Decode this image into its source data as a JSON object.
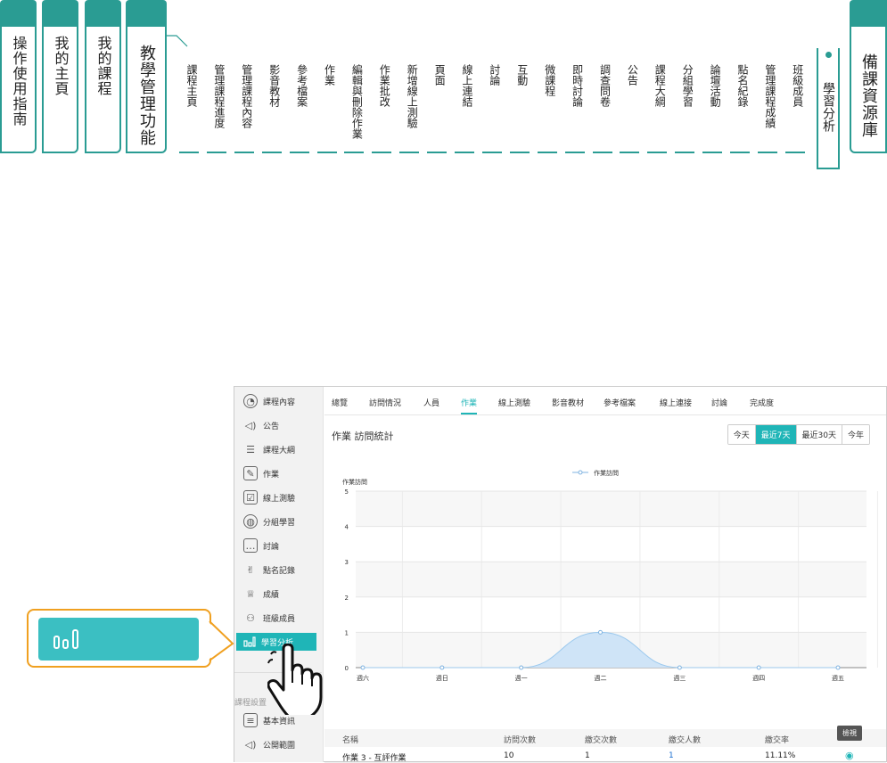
{
  "top_nav": {
    "main_tabs": [
      "操作使用指南",
      "我的主頁",
      "我的課程",
      "教學管理功能"
    ],
    "sub_tabs": [
      "課程主頁",
      "管理課程進度",
      "管理課程內容",
      "影音教材",
      "參考檔案",
      "作業",
      "編輯與刪除作業",
      "作業批改",
      "新增線上測驗",
      "頁面",
      "線上連結",
      "討論",
      "互動",
      "微課程",
      "即時討論",
      "調查問卷",
      "公告",
      "課程大綱",
      "分組學習",
      "論壇活動",
      "點名紀錄",
      "管理課程成績",
      "班級成員"
    ],
    "active_sub_tab": "學習分析",
    "right_tab": "備課資源庫"
  },
  "sidebar": {
    "items": [
      "課程內容",
      "公告",
      "課程大綱",
      "作業",
      "線上測驗",
      "分組學習",
      "討論",
      "點名記錄",
      "成績",
      "班級成員",
      "學習分析"
    ],
    "section_label": "課程設置",
    "section_items": [
      "基本資訊",
      "公開範圍"
    ]
  },
  "tabs": [
    "總覽",
    "訪問情況",
    "人員",
    "作業",
    "線上測驗",
    "影音教材",
    "參考檔案",
    "線上連接",
    "討論",
    "完成度"
  ],
  "active_tab": "作業",
  "content_title": "作業 訪問統計",
  "range_buttons": [
    "今天",
    "最近7天",
    "最近30天",
    "今年"
  ],
  "active_range": "最近7天",
  "chart_data": {
    "type": "area",
    "legend": "作業訪問",
    "ylabel": "作業訪問",
    "categories": [
      "週六",
      "週日",
      "週一",
      "週二",
      "週三",
      "週四",
      "週五"
    ],
    "series": [
      {
        "name": "作業訪問",
        "values": [
          0,
          0,
          0,
          1,
          0,
          0,
          0
        ]
      }
    ],
    "ylim": [
      0,
      5
    ],
    "yticks": [
      0,
      1,
      2,
      3,
      4,
      5
    ],
    "grid": true,
    "legend_position": "top-center",
    "color": "#9cc9ee"
  },
  "table": {
    "headers": [
      "名稱",
      "訪問次數",
      "繳交次數",
      "繳交人數",
      "繳交率"
    ],
    "rows": [
      {
        "name": "作業 3 - 互評作業",
        "visits": "10",
        "submissions": "1",
        "submitters": "1",
        "rate": "11.11%"
      }
    ]
  },
  "tooltip": "檢視",
  "colors": {
    "accent": "#1fb5b7",
    "nav": "#2a9c93",
    "callout": "#f0a020"
  }
}
